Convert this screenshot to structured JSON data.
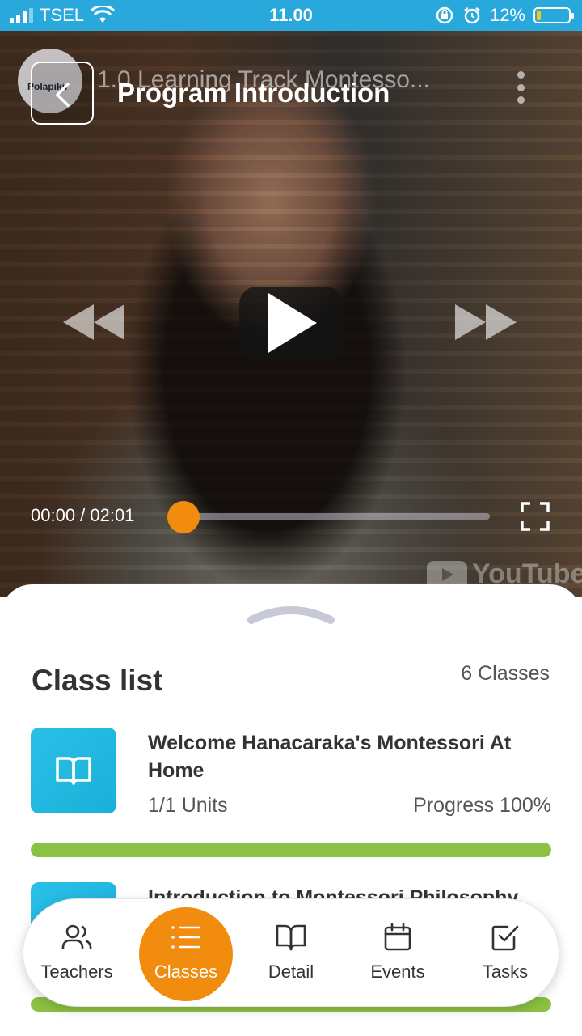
{
  "status_bar": {
    "carrier": "TSEL",
    "time": "11.00",
    "battery_percent": "12%",
    "battery_level": 0.12
  },
  "video": {
    "channel_logo_text": "Polapikir",
    "youtube_title": "1.0 Learning Track Montesso...",
    "page_title": "Program Introduction",
    "time_display": "00:00 / 02:01",
    "watermark": "YouTube",
    "progress": 0
  },
  "class_list": {
    "heading": "Class list",
    "count": "6 Classes",
    "items": [
      {
        "title": "Welcome Hanacaraka's Montessori At Home",
        "units": "1/1 Units",
        "progress_label": "Progress 100%",
        "progress": 1.0
      },
      {
        "title": "Introduction to Montessori Philosophy",
        "units": "",
        "progress_label": "",
        "progress": 1.0
      }
    ]
  },
  "nav": {
    "items": [
      {
        "label": "Teachers",
        "icon": "users-icon",
        "active": false
      },
      {
        "label": "Classes",
        "icon": "list-icon",
        "active": true
      },
      {
        "label": "Detail",
        "icon": "book-icon",
        "active": false
      },
      {
        "label": "Events",
        "icon": "calendar-icon",
        "active": false
      },
      {
        "label": "Tasks",
        "icon": "checkbox-icon",
        "active": false
      }
    ]
  },
  "colors": {
    "accent": "#f28c0f",
    "status_bar": "#29a8dc",
    "progress": "#8cc243",
    "class_icon": "#29bfe6"
  }
}
